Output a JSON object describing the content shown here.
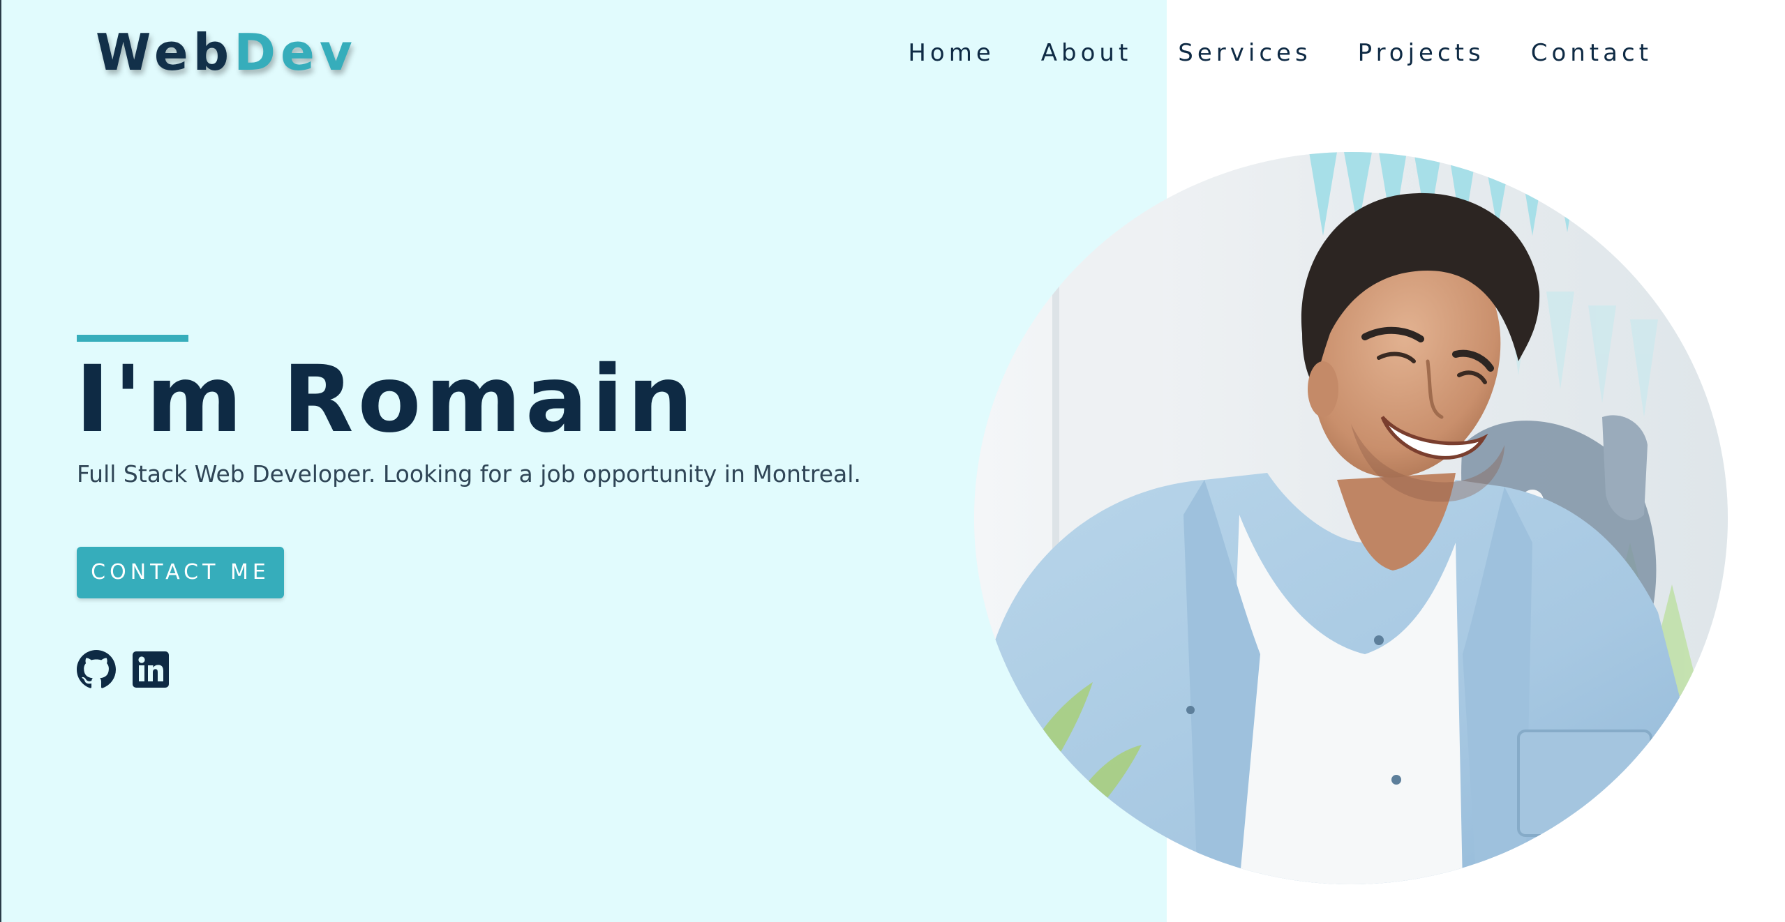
{
  "brand": {
    "logo_part_a": "Web",
    "logo_part_b": "Dev"
  },
  "nav": {
    "items": [
      {
        "label": "Home"
      },
      {
        "label": "About"
      },
      {
        "label": "Services"
      },
      {
        "label": "Projects"
      },
      {
        "label": "Contact"
      }
    ]
  },
  "hero": {
    "title": "I'm Romain",
    "subtitle": "Full Stack Web Developer. Looking for a job opportunity in Montreal.",
    "cta_label": "CONTACT ME"
  },
  "social": [
    {
      "icon": "github-icon"
    },
    {
      "icon": "linkedin-icon"
    }
  ],
  "portrait": {
    "icon": "profile-photo"
  },
  "colors": {
    "accent": "#36adbb",
    "dark": "#0e2a44",
    "panel_bg": "#e1fbfd",
    "page_bg": "#ffffff"
  }
}
